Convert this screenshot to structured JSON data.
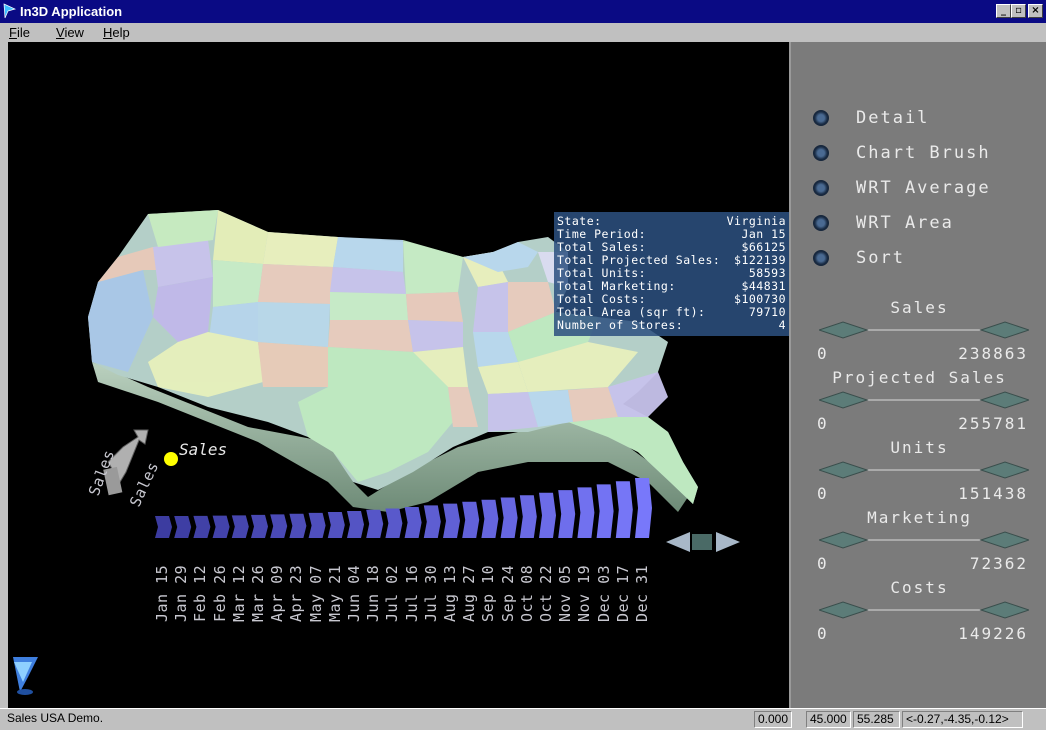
{
  "window": {
    "title": "In3D Application",
    "min": "_",
    "max": "▫",
    "close": "×"
  },
  "menu": [
    {
      "label": "File",
      "ul": "F",
      "rest": "ile"
    },
    {
      "label": "View",
      "ul": "V",
      "rest": "iew"
    },
    {
      "label": "Help",
      "ul": "H",
      "rest": "elp"
    }
  ],
  "info": {
    "rows": [
      {
        "k": "State:",
        "v": "Virginia"
      },
      {
        "k": "Time Period:",
        "v": "Jan 15"
      },
      {
        "k": "Total Sales:",
        "v": "$66125"
      },
      {
        "k": "Total Projected Sales:",
        "v": "$122139"
      },
      {
        "k": "Total Units:",
        "v": "58593"
      },
      {
        "k": "Total Marketing:",
        "v": "$44831"
      },
      {
        "k": "Total Costs:",
        "v": "$100730"
      },
      {
        "k": "Total Area (sqr ft):",
        "v": "79710"
      },
      {
        "k": "Number of Stores:",
        "v": "4"
      }
    ]
  },
  "legend": {
    "label": "Sales",
    "axis1": "Sales",
    "axis2": "Sales",
    "dot_color": "#ffff00"
  },
  "timeline": {
    "labels": [
      "Jan 15",
      "Jan 29",
      "Feb 12",
      "Feb 26",
      "Mar 12",
      "Mar 26",
      "Apr 09",
      "Apr 23",
      "May 07",
      "May 21",
      "Jun 04",
      "Jun 18",
      "Jul 02",
      "Jul 16",
      "Jul 30",
      "Aug 13",
      "Aug 27",
      "Sep 10",
      "Sep 24",
      "Oct 08",
      "Oct 22",
      "Nov 05",
      "Nov 19",
      "Dec 03",
      "Dec 17",
      "Dec 31"
    ]
  },
  "options": [
    {
      "label": "Detail"
    },
    {
      "label": "Chart Brush"
    },
    {
      "label": "WRT Average"
    },
    {
      "label": "WRT Area"
    },
    {
      "label": "Sort"
    }
  ],
  "sliders": [
    {
      "title": "Sales",
      "min": "0",
      "max": "238863"
    },
    {
      "title": "Projected Sales",
      "min": "0",
      "max": "255781"
    },
    {
      "title": "Units",
      "min": "0",
      "max": "151438"
    },
    {
      "title": "Marketing",
      "min": "0",
      "max": "72362"
    },
    {
      "title": "Costs",
      "min": "0",
      "max": "149226"
    }
  ],
  "status": {
    "message": "Sales USA Demo.",
    "v1": "0.000",
    "v2": "45.000",
    "v3": "55.285",
    "v4": "<-0.27,-4.35,-0.12>"
  },
  "colors": {
    "title_bar": "#0a0a84",
    "viewport_bg": "#000000",
    "panel_bg": "#7b7b7b"
  }
}
